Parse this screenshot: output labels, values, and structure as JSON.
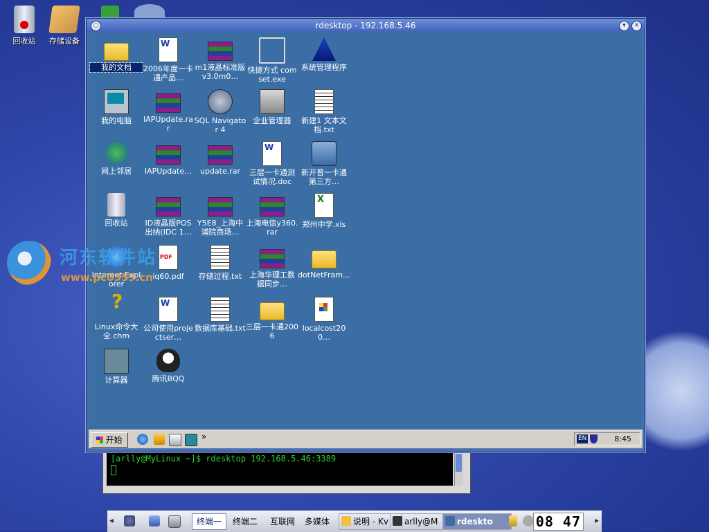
{
  "host_desktop": {
    "icons": [
      {
        "label": "回收站",
        "icon": "trash-icon"
      },
      {
        "label": "存储设备",
        "icon": "storage-icon"
      }
    ]
  },
  "rdesktop": {
    "title": "rdesktop - 192.168.5.46",
    "desktop_icons": [
      {
        "label": "我的文档",
        "icon": "folder-icon",
        "selected": true
      },
      {
        "label": "2006年度一卡通产品…",
        "icon": "word-doc-icon"
      },
      {
        "label": "m1液晶标准版v3.0m0…",
        "icon": "rar-archive-icon"
      },
      {
        "label": "快捷方式 comset.exe",
        "icon": "shortcut-exe-icon"
      },
      {
        "label": "系统管理程序",
        "icon": "system-admin-icon"
      },
      {
        "label": "我的电脑",
        "icon": "computer-icon"
      },
      {
        "label": "IAPUpdate.rar",
        "icon": "rar-archive-icon"
      },
      {
        "label": "SQL Navigator 4",
        "icon": "sql-navigator-icon"
      },
      {
        "label": "企业管理器",
        "icon": "enterprise-manager-icon"
      },
      {
        "label": "新建1 文本文档.txt",
        "icon": "text-file-icon"
      },
      {
        "label": "网上邻居",
        "icon": "network-icon"
      },
      {
        "label": "IAPUpdate…",
        "icon": "rar-archive-icon"
      },
      {
        "label": "update.rar",
        "icon": "rar-archive-icon"
      },
      {
        "label": "三层一卡通测试情况.doc",
        "icon": "word-doc-icon"
      },
      {
        "label": "新开普一卡通第三方…",
        "icon": "setup-icon"
      },
      {
        "label": "回收站",
        "icon": "recycle-bin-icon"
      },
      {
        "label": "ID液晶版POS出纳(IDC 1…",
        "icon": "rar-archive-icon"
      },
      {
        "label": "Y5E8_上海中浦院商场…",
        "icon": "rar-archive-icon"
      },
      {
        "label": "上海电信y360.rar",
        "icon": "rar-archive-icon"
      },
      {
        "label": "郑州中学.xls",
        "icon": "excel-icon"
      },
      {
        "label": "Internet Explorer",
        "icon": "ie-icon"
      },
      {
        "label": "iq60.pdf",
        "icon": "pdf-icon"
      },
      {
        "label": "存储过程.txt",
        "icon": "text-file-icon"
      },
      {
        "label": "上海华理工数据同步…",
        "icon": "rar-archive-icon"
      },
      {
        "label": "dotNetFram…",
        "icon": "folder-icon"
      },
      {
        "label": "Linux命令大全.chm",
        "icon": "chm-help-icon"
      },
      {
        "label": "公司使用projectser…",
        "icon": "word-doc-icon"
      },
      {
        "label": "数据库基础.txt",
        "icon": "text-file-icon"
      },
      {
        "label": "三层一卡通2006",
        "icon": "folder-icon"
      },
      {
        "label": "localcost200…",
        "icon": "installer-icon"
      },
      {
        "label": "计算器",
        "icon": "calculator-icon"
      },
      {
        "label": "腾讯BQQ",
        "icon": "qq-icon"
      }
    ],
    "taskbar": {
      "start_label": "开始",
      "more": "»",
      "lang": "EN",
      "clock": "8:45"
    }
  },
  "terminal": {
    "prompt": "[arlly@MyLinux ~]$ rdesktop 192.168.5.46:3389"
  },
  "watermark": {
    "title": "河东软件站",
    "url": "www.pc0359.cn"
  },
  "kde_panel": {
    "desktops": [
      "终端一",
      "终端二",
      "互联网",
      "多媒体"
    ],
    "active_desktop": "终端一",
    "tasks": [
      {
        "label": "说明 - Kv",
        "icon": "browser-icon"
      },
      {
        "label": "arlly@M",
        "icon": "terminal-icon"
      },
      {
        "label": "rdeskto",
        "icon": "rdesktop-icon",
        "active": true
      }
    ],
    "clock": "08 47"
  },
  "colors": {
    "win_desktop": "#3a6ea5",
    "host_bg": "#2e46a8",
    "terminal_text": "#2fd12f"
  }
}
